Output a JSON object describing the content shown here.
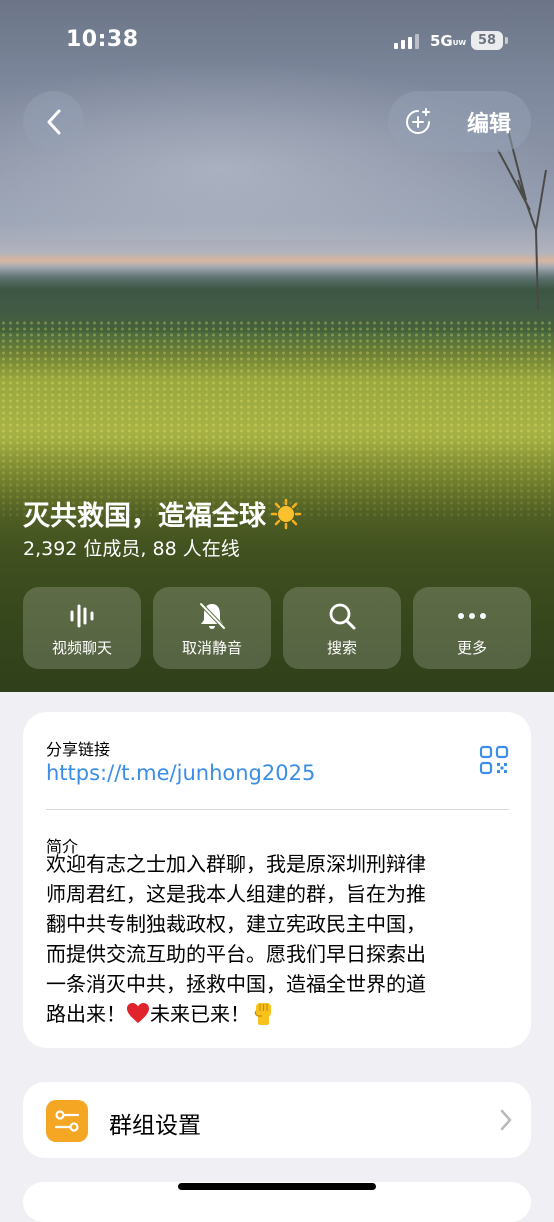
{
  "status_bar": {
    "time": "10:38",
    "network": "5G",
    "network_suffix": "UW",
    "battery": "58"
  },
  "header": {
    "edit_label": "编辑"
  },
  "group": {
    "title": "灭共救国，造福全球",
    "subtitle": "2,392 位成员, 88 人在线"
  },
  "actions": [
    {
      "label": "视频聊天",
      "icon": "voice-chat-icon"
    },
    {
      "label": "取消静音",
      "icon": "bell-slash-icon"
    },
    {
      "label": "搜索",
      "icon": "search-icon"
    },
    {
      "label": "更多",
      "icon": "more-icon"
    }
  ],
  "share": {
    "label": "分享链接",
    "link": "https://t.me/junhong2025"
  },
  "about": {
    "label": "简介",
    "lines": [
      "欢迎有志之士加入群聊，我是原深圳刑辩律",
      "师周君红，这是我本人组建的群，旨在为推",
      "翻中共专制独裁政权，建立宪政民主中国，",
      "而提供交流互助的平台。愿我们早日探索出",
      "一条消灭中共，拯救中国，造福全世界的道"
    ],
    "last_line_part1": "路出来！",
    "last_line_part2": "未来已来！"
  },
  "settings": {
    "label": "群组设置"
  },
  "colors": {
    "link": "#3a8ee6",
    "settings_icon_bg": "#f5a623"
  }
}
